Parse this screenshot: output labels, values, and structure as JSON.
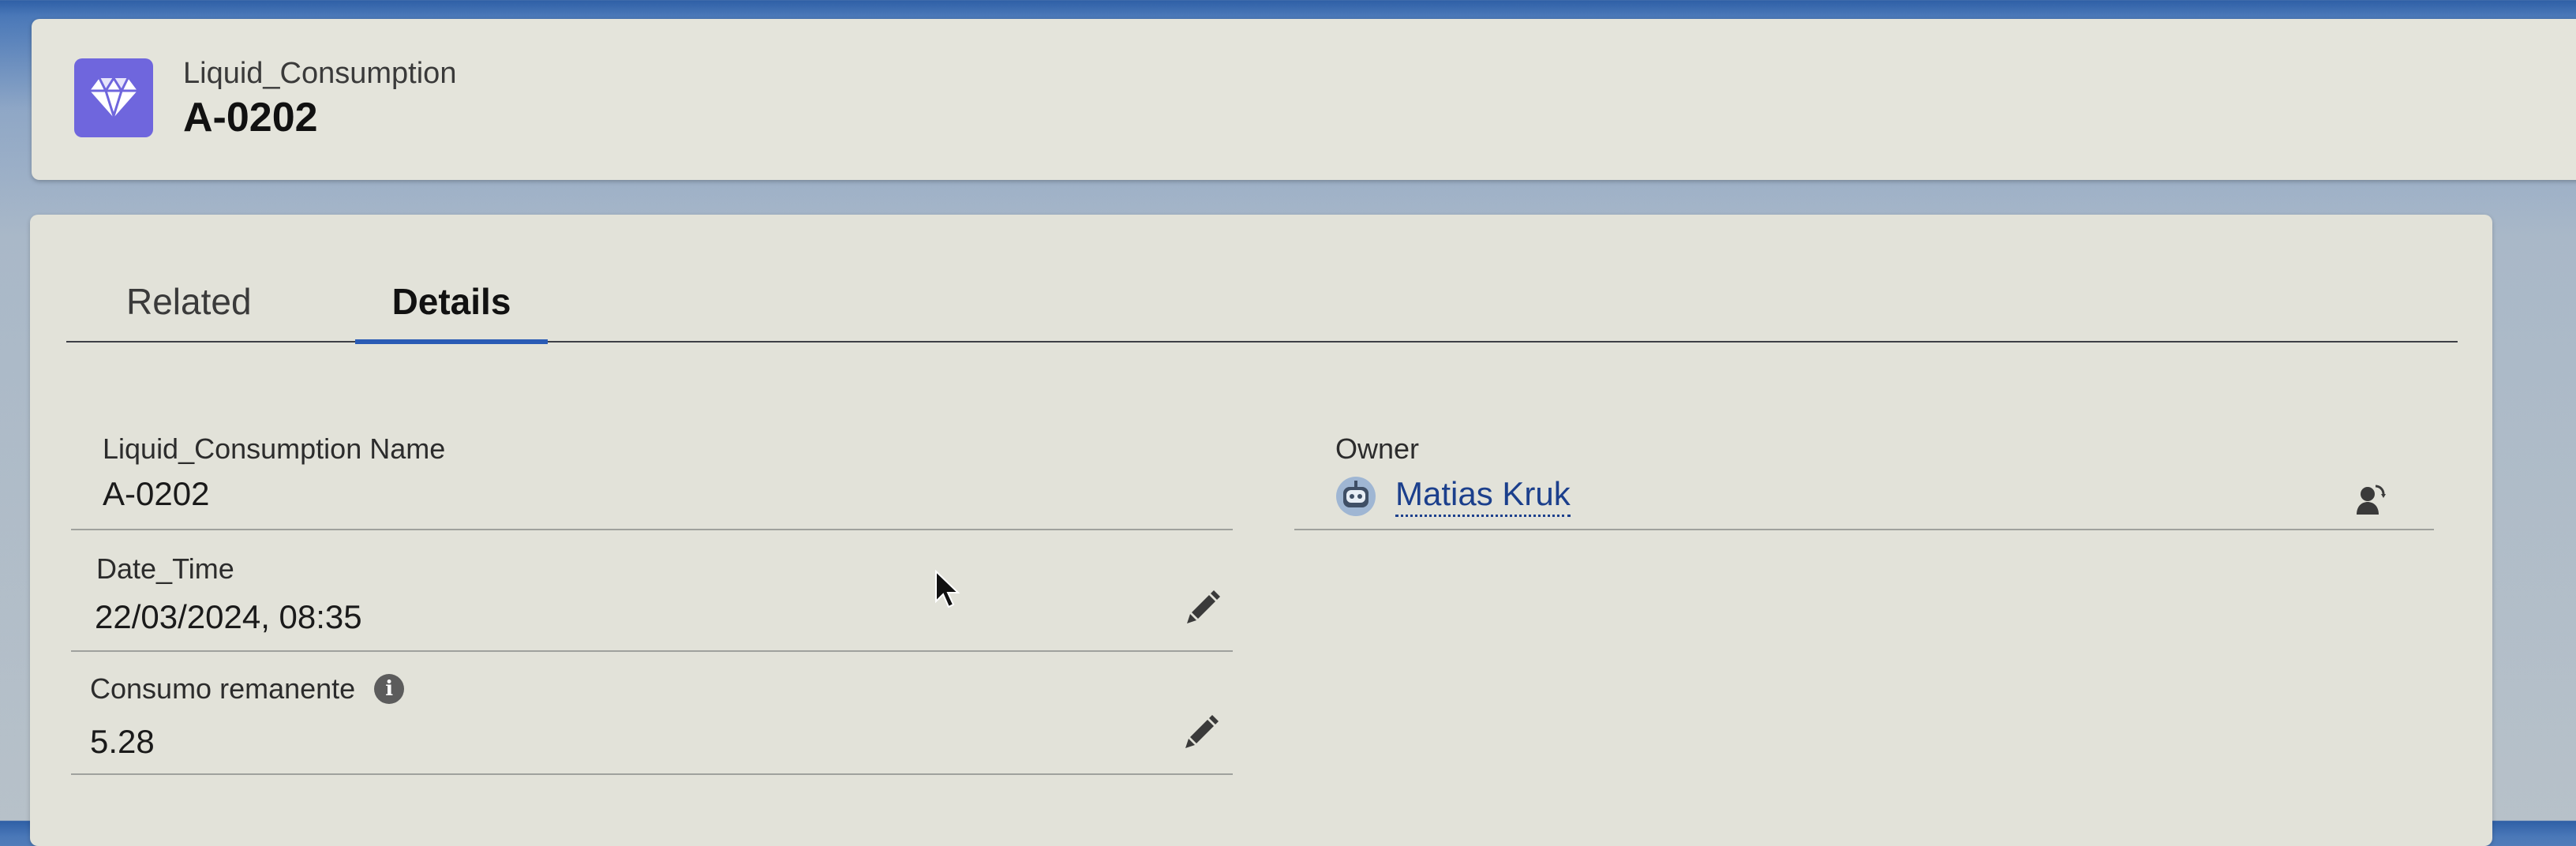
{
  "header": {
    "object_type": "Liquid_Consumption",
    "record_name": "A-0202",
    "icon": "diamond-icon"
  },
  "tabs": [
    {
      "label": "Related",
      "active": false
    },
    {
      "label": "Details",
      "active": true
    }
  ],
  "fields": {
    "name": {
      "label": "Liquid_Consumption Name",
      "value": "A-0202"
    },
    "owner": {
      "label": "Owner",
      "value": "Matias Kruk",
      "avatar": "robot-avatar-icon",
      "action_icon": "change-owner-icon"
    },
    "date_time": {
      "label": "Date_Time",
      "value": "22/03/2024, 08:35",
      "action_icon": "pencil-edit-icon"
    },
    "consumo": {
      "label": "Consumo remanente",
      "value": "5.28",
      "info_icon": "info-icon",
      "action_icon": "pencil-edit-icon"
    }
  },
  "colors": {
    "accent": "#2a5bb5",
    "icon_bg": "#6f66dd",
    "link": "#1b3f8c",
    "card_bg": "#e2e2d9"
  }
}
